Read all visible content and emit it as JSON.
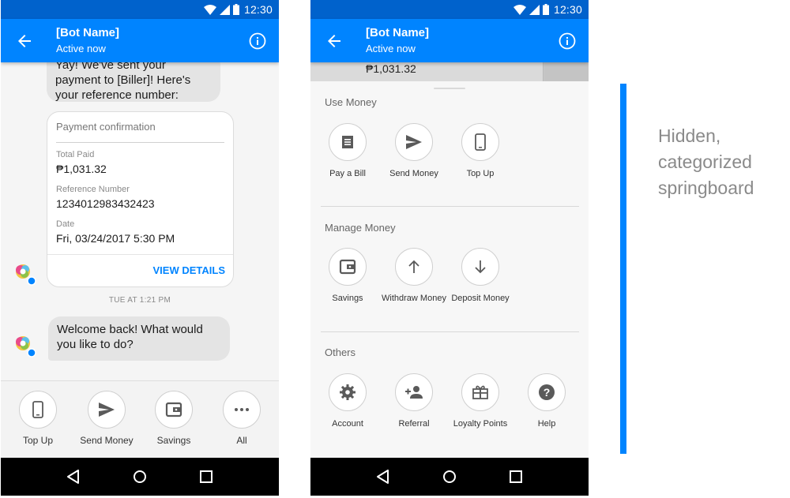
{
  "status_bar": {
    "time": "12:30"
  },
  "header": {
    "title": "[Bot Name]",
    "subtitle": "Active now"
  },
  "chat": {
    "message1": "Yay! We've sent your payment to [Biller]! Here's your reference number:",
    "card": {
      "heading": "Payment confirmation",
      "fields": [
        {
          "label": "Total Paid",
          "value": "₱1,031.32"
        },
        {
          "label": "Reference Number",
          "value": "1234012983432423"
        },
        {
          "label": "Date",
          "value": "Fri, 03/24/2017 5:30 PM"
        }
      ],
      "action": "VIEW DETAILS"
    },
    "timestamp": "TUE AT 1:21 PM",
    "message2": "Welcome back! What would you like to do?"
  },
  "quick_actions": [
    {
      "label": "Top Up",
      "icon": "phone-icon"
    },
    {
      "label": "Send Money",
      "icon": "send-icon"
    },
    {
      "label": "Savings",
      "icon": "wallet-icon"
    },
    {
      "label": "All",
      "icon": "more-icon"
    }
  ],
  "springboard": {
    "peek_value": "₱1,031.32",
    "sections": [
      {
        "title": "Use Money",
        "items": [
          {
            "label": "Pay a Bill",
            "icon": "bill-icon"
          },
          {
            "label": "Send Money",
            "icon": "send-icon"
          },
          {
            "label": "Top Up",
            "icon": "phone-icon"
          }
        ]
      },
      {
        "title": "Manage Money",
        "items": [
          {
            "label": "Savings",
            "icon": "wallet-icon"
          },
          {
            "label": "Withdraw Money",
            "icon": "arrow-up-icon"
          },
          {
            "label": "Deposit Money",
            "icon": "arrow-down-icon"
          }
        ]
      },
      {
        "title": "Others",
        "items": [
          {
            "label": "Account",
            "icon": "gear-icon"
          },
          {
            "label": "Referral",
            "icon": "add-person-icon"
          },
          {
            "label": "Loyalty Points",
            "icon": "gift-icon"
          },
          {
            "label": "Help",
            "icon": "help-icon"
          }
        ]
      }
    ]
  },
  "caption": {
    "lines": [
      "Hidden,",
      "categorized",
      "springboard"
    ]
  },
  "colors": {
    "brand": "#0084ff",
    "status_bar": "#0062cc",
    "accent_bar": "#0084ff"
  }
}
